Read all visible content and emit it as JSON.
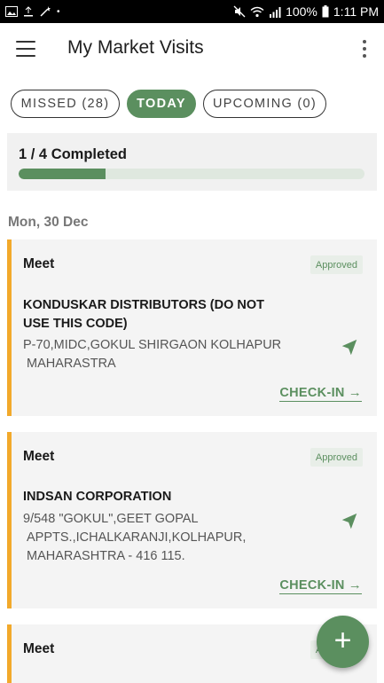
{
  "status_bar": {
    "battery": "100%",
    "time": "1:11 PM"
  },
  "app_bar": {
    "title": "My Market Visits"
  },
  "tabs": [
    {
      "label": "MISSED (28)",
      "active": false
    },
    {
      "label": "TODAY",
      "active": true
    },
    {
      "label": "UPCOMING (0)",
      "active": false
    }
  ],
  "progress": {
    "label": "1 / 4 Completed",
    "completed": 1,
    "total": 4
  },
  "date_header": "Mon, 30 Dec",
  "visits": [
    {
      "type": "Meet",
      "status": "Approved",
      "name": "KONDUSKAR DISTRIBUTORS (DO NOT USE THIS CODE)",
      "address": "P-70,MIDC,GOKUL SHIRGAON KOLHAPUR MAHARASTRA",
      "action": "CHECK-IN"
    },
    {
      "type": "Meet",
      "status": "Approved",
      "name": "INDSAN CORPORATION",
      "address": "9/548 \"GOKUL\",GEET GOPAL APPTS.,ICHALKARANJI,KOLHAPUR, MAHARASHTRA - 416 115.",
      "action": "CHECK-IN"
    },
    {
      "type": "Meet",
      "status": "Approved"
    }
  ],
  "fab": {
    "label": "+"
  },
  "colors": {
    "accent": "#5b8f5f",
    "card_border": "#f2a92b",
    "status_bar": "#000000"
  },
  "icons": {
    "menu": "hamburger-icon",
    "overflow": "more-vertical-icon",
    "navigate": "navigation-arrow-icon",
    "checkin_arrow": "arrow-right-icon",
    "fab": "plus-icon"
  }
}
